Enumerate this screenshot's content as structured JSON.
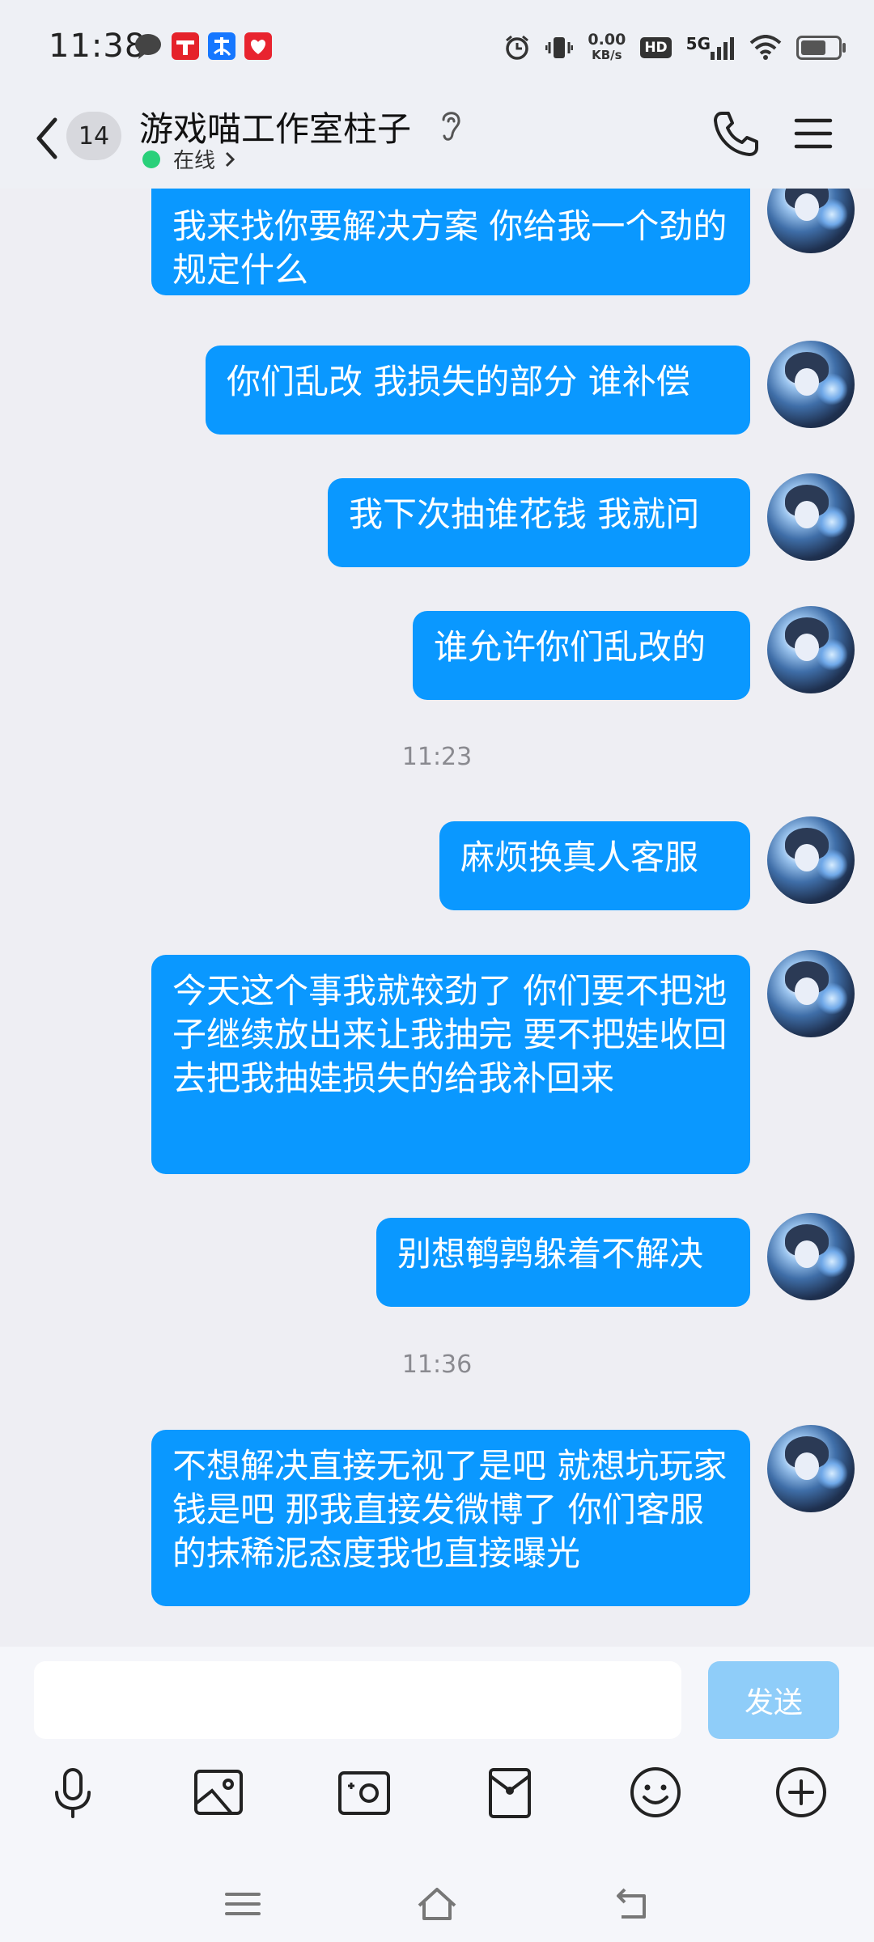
{
  "status_bar": {
    "time": "11:38",
    "net_speed_value": "0.00",
    "net_speed_unit": "KB/s",
    "hd_label": "HD",
    "network_label": "5G",
    "notification_icons": [
      "chat-bubble-icon",
      "tmall-icon",
      "alipay-icon",
      "taobao-icon"
    ],
    "system_icons": [
      "alarm-icon",
      "vibrate-icon",
      "signal-icon",
      "wifi-icon",
      "battery-icon"
    ]
  },
  "header": {
    "unread_count": "14",
    "title": "游戏喵工作室柱子",
    "status": "在线",
    "status_color": "#29d07a"
  },
  "messages": [
    {
      "type": "sent",
      "text": "我来找你要解决方案 你给我一个劲的规定什么"
    },
    {
      "type": "sent",
      "text": "你们乱改 我损失的部分 谁补偿"
    },
    {
      "type": "sent",
      "text": "我下次抽谁花钱 我就问"
    },
    {
      "type": "sent",
      "text": "谁允许你们乱改的"
    },
    {
      "type": "time",
      "text": "11:23"
    },
    {
      "type": "sent",
      "text": "麻烦换真人客服"
    },
    {
      "type": "sent",
      "text": "今天这个事我就较劲了 你们要不把池子继续放出来让我抽完 要不把娃收回去把我抽娃损失的给我补回来"
    },
    {
      "type": "sent",
      "text": "别想鹌鹑躲着不解决"
    },
    {
      "type": "time",
      "text": "11:36"
    },
    {
      "type": "sent",
      "text": "不想解决直接无视了是吧 就想坑玩家钱是吧 那我直接发微博了 你们客服的抹稀泥态度我也直接曝光"
    }
  ],
  "input": {
    "value": "",
    "send_label": "发送",
    "bubble_color": "#0a98ff"
  },
  "toolbar_icons": [
    "microphone-icon",
    "image-icon",
    "camera-icon",
    "red-packet-icon",
    "emoji-icon",
    "plus-icon"
  ],
  "nav_icons": [
    "menu-nav-icon",
    "home-nav-icon",
    "back-nav-icon"
  ]
}
